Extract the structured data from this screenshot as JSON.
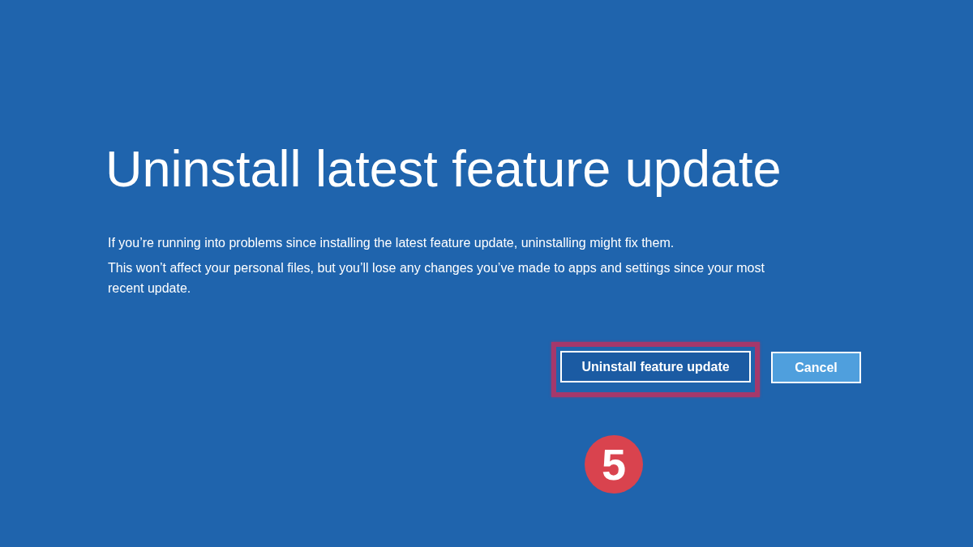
{
  "screen": {
    "title": "Uninstall latest feature update",
    "paragraphs": [
      "If you’re running into problems since installing the latest feature update, uninstalling might fix them.",
      "This won’t affect your personal files, but you’ll lose any changes you’ve made to apps and settings since your most recent update."
    ]
  },
  "buttons": [
    {
      "label": "Uninstall feature update",
      "kind": "primary",
      "highlighted": true
    },
    {
      "label": "Cancel",
      "kind": "secondary",
      "highlighted": false
    }
  ],
  "step_badge": {
    "label": "5"
  }
}
